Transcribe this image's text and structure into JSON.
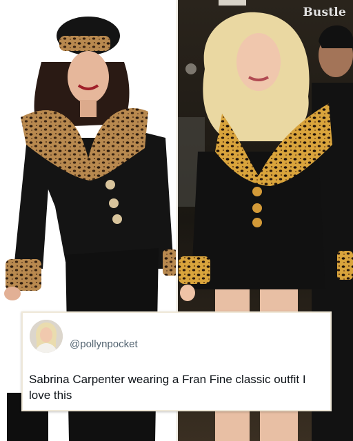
{
  "watermark": "Bustle",
  "tweet": {
    "handle": "@pollynpocket",
    "text": "Sabrina Carpenter wearing a Fran Fine classic outfit I love this"
  },
  "left_photo": {
    "subject": "woman in black suit with leopard fur collar and cuffs, black beret",
    "background_color": "#ffffff"
  },
  "right_photo": {
    "subject": "blonde woman in black jacket with leopard collar and cuffs on street at night",
    "background_color": "#1a1712"
  },
  "colors": {
    "leopard_base": "#b8894f",
    "leopard_spot": "#2b1a0d",
    "jacket": "#141414",
    "card_border": "#efe8d8"
  },
  "icons": {
    "avatar": "profile-avatar"
  }
}
